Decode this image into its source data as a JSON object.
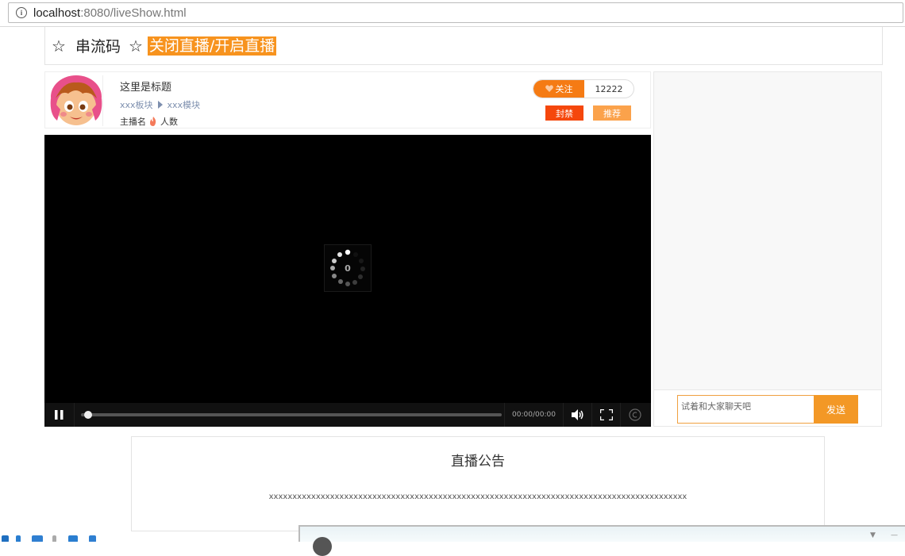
{
  "browser": {
    "url_host": "localhost",
    "url_rest": ":8080/liveShow.html"
  },
  "header": {
    "star_left": "☆",
    "title": "串流码",
    "star_right": "☆",
    "toggle_label": "关闭直播/开启直播"
  },
  "room": {
    "title": "这里是标题",
    "board": "xxx板块",
    "module": "xxx模块",
    "anchor_name": "主播名",
    "viewers_label": "人数",
    "follow_label": "关注",
    "follow_count": "12222",
    "ban_label": "封禁",
    "recommend_label": "推荐"
  },
  "player": {
    "loading_percent": "0",
    "time": "00:00/00:00",
    "progress": 0
  },
  "chat": {
    "placeholder": "试着和大家聊天吧",
    "send_label": "发送"
  },
  "notice": {
    "title": "直播公告",
    "body": "xxxxxxxxxxxxxxxxxxxxxxxxxxxxxxxxxxxxxxxxxxxxxxxxxxxxxxxxxxxxxxxxxxxxxxxxxxxxxxxxxxxxxxxxx"
  },
  "colors": {
    "accent_orange": "#f7931e",
    "follow_orange": "#f57b14",
    "ban_red": "#f5470c",
    "recommend_orange": "#fba24b",
    "send_orange": "#f39826",
    "crumb_blue": "#7d8fae"
  },
  "icons": {
    "address": "info-icon",
    "follow": "heart-icon",
    "viewers": "fire-icon",
    "crumb": "triangle-right-icon"
  }
}
